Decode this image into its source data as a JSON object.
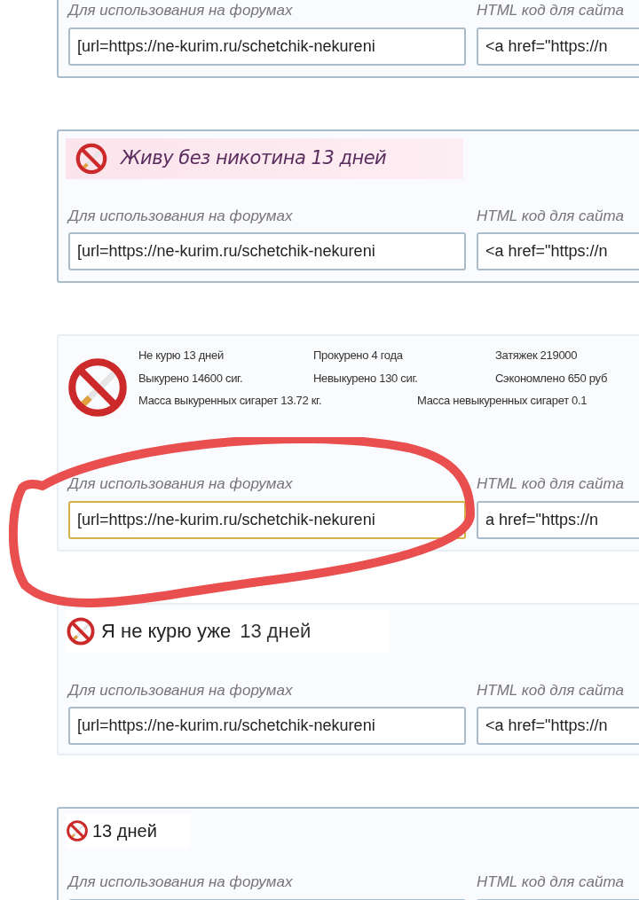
{
  "cards": [
    {
      "fields": [
        {
          "label": "Для использования на форумах",
          "value": "[url=https://ne-kurim.ru/schetchik-nekureni",
          "focused": false
        },
        {
          "label": "HTML код для сайта",
          "value": "<a href=\"https://n",
          "focused": false
        }
      ]
    },
    {
      "banner": {
        "kind": "italic",
        "text": "Живу без никотина 13 дней"
      },
      "fields": [
        {
          "label": "Для использования на форумах",
          "value": "[url=https://ne-kurim.ru/schetchik-nekureni",
          "focused": false
        },
        {
          "label": "HTML код для сайта",
          "value": "<a href=\"https://n",
          "focused": false
        }
      ]
    },
    {
      "banner": {
        "kind": "stats",
        "rows": [
          [
            "Не курю 13 дней",
            "Прокурено 4 года",
            "Затяжек 219000"
          ],
          [
            "Выкурено 14600 сиг.",
            "Невыкурено 130 сиг.",
            "Сэкономлено 650 руб"
          ]
        ],
        "mass_smoked": "Масса выкуренных сигарет 13.72 кг.",
        "mass_unsmoked": "Масса невыкуренных сигарет 0.1"
      },
      "fields": [
        {
          "label": "Для использования на форумах",
          "value": "[url=https://ne-kurim.ru/schetchik-nekureni",
          "focused": true
        },
        {
          "label": "HTML код для сайта",
          "value": "a href=\"https://n",
          "focused": false
        }
      ]
    },
    {
      "banner": {
        "kind": "plain",
        "text": "Я не курю уже",
        "count": "13 дней"
      },
      "fields": [
        {
          "label": "Для использования на форумах",
          "value": "[url=https://ne-kurim.ru/schetchik-nekureni",
          "focused": false
        },
        {
          "label": "HTML код для сайта",
          "value": "<a href=\"https://n",
          "focused": false
        }
      ]
    },
    {
      "banner": {
        "kind": "small",
        "text": "13 дней"
      },
      "fields": [
        {
          "label": "Для использования на форумах",
          "focused": false
        },
        {
          "label": "HTML код для сайта",
          "focused": false
        }
      ]
    }
  ]
}
